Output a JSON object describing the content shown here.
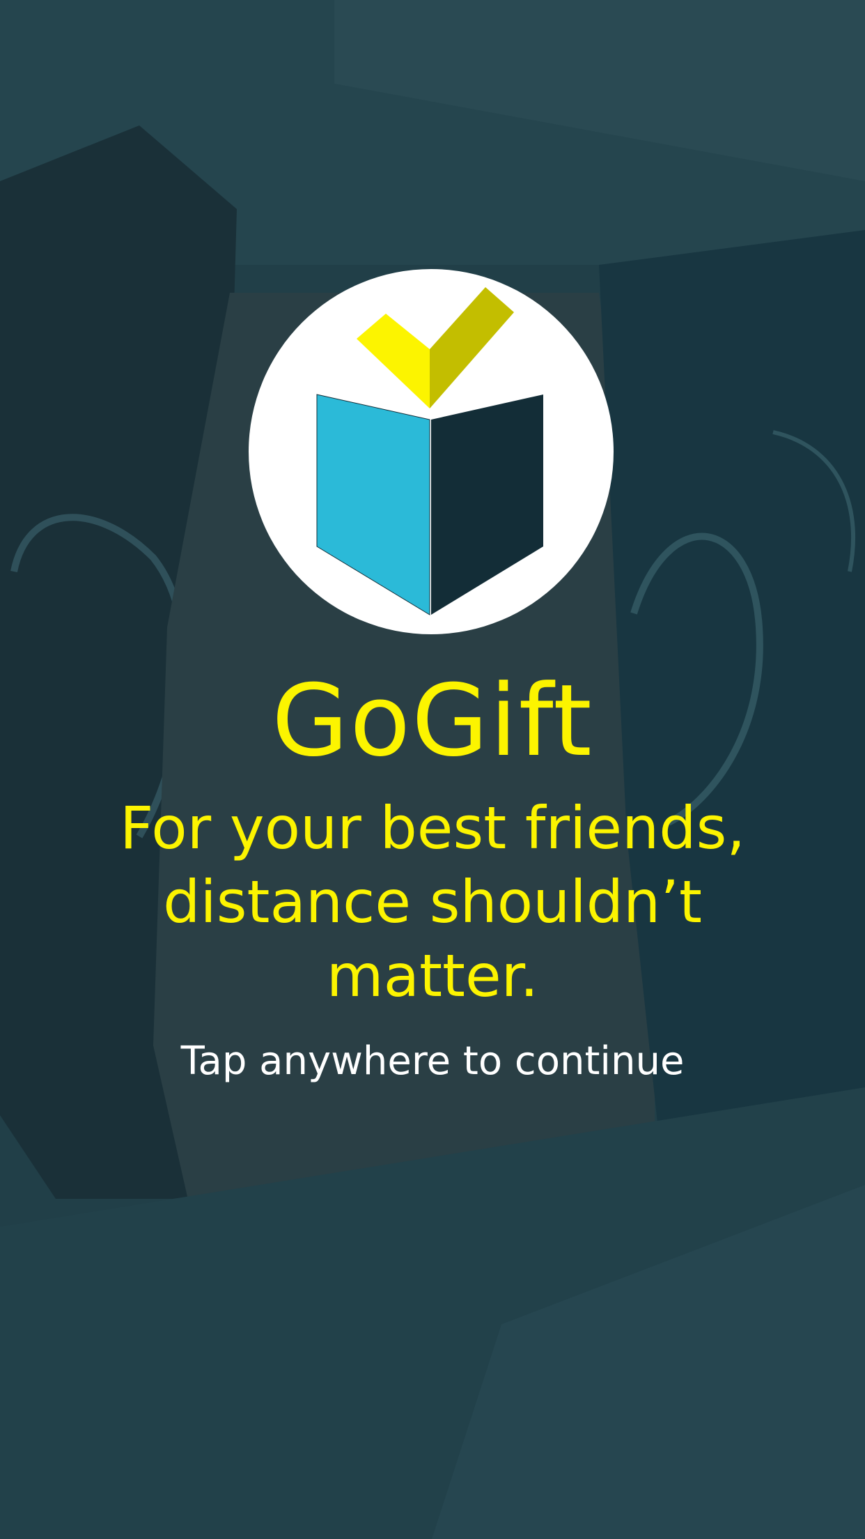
{
  "app": {
    "title": "GoGift",
    "tagline": "For your best friends, distance shouldn’t matter.",
    "tap_hint": "Tap anywhere to continue"
  },
  "logo": {
    "icon": "open-book-with-checkmark-icon",
    "circle_color": "#ffffff",
    "book_left_color": "#2bbad8",
    "book_right_color": "#132d37",
    "check_light_color": "#fcf400",
    "check_dark_color": "#c3be00"
  },
  "colors": {
    "background_tint": "#1d3a43",
    "title_text": "#fcf400",
    "hint_text": "#ffffff"
  }
}
